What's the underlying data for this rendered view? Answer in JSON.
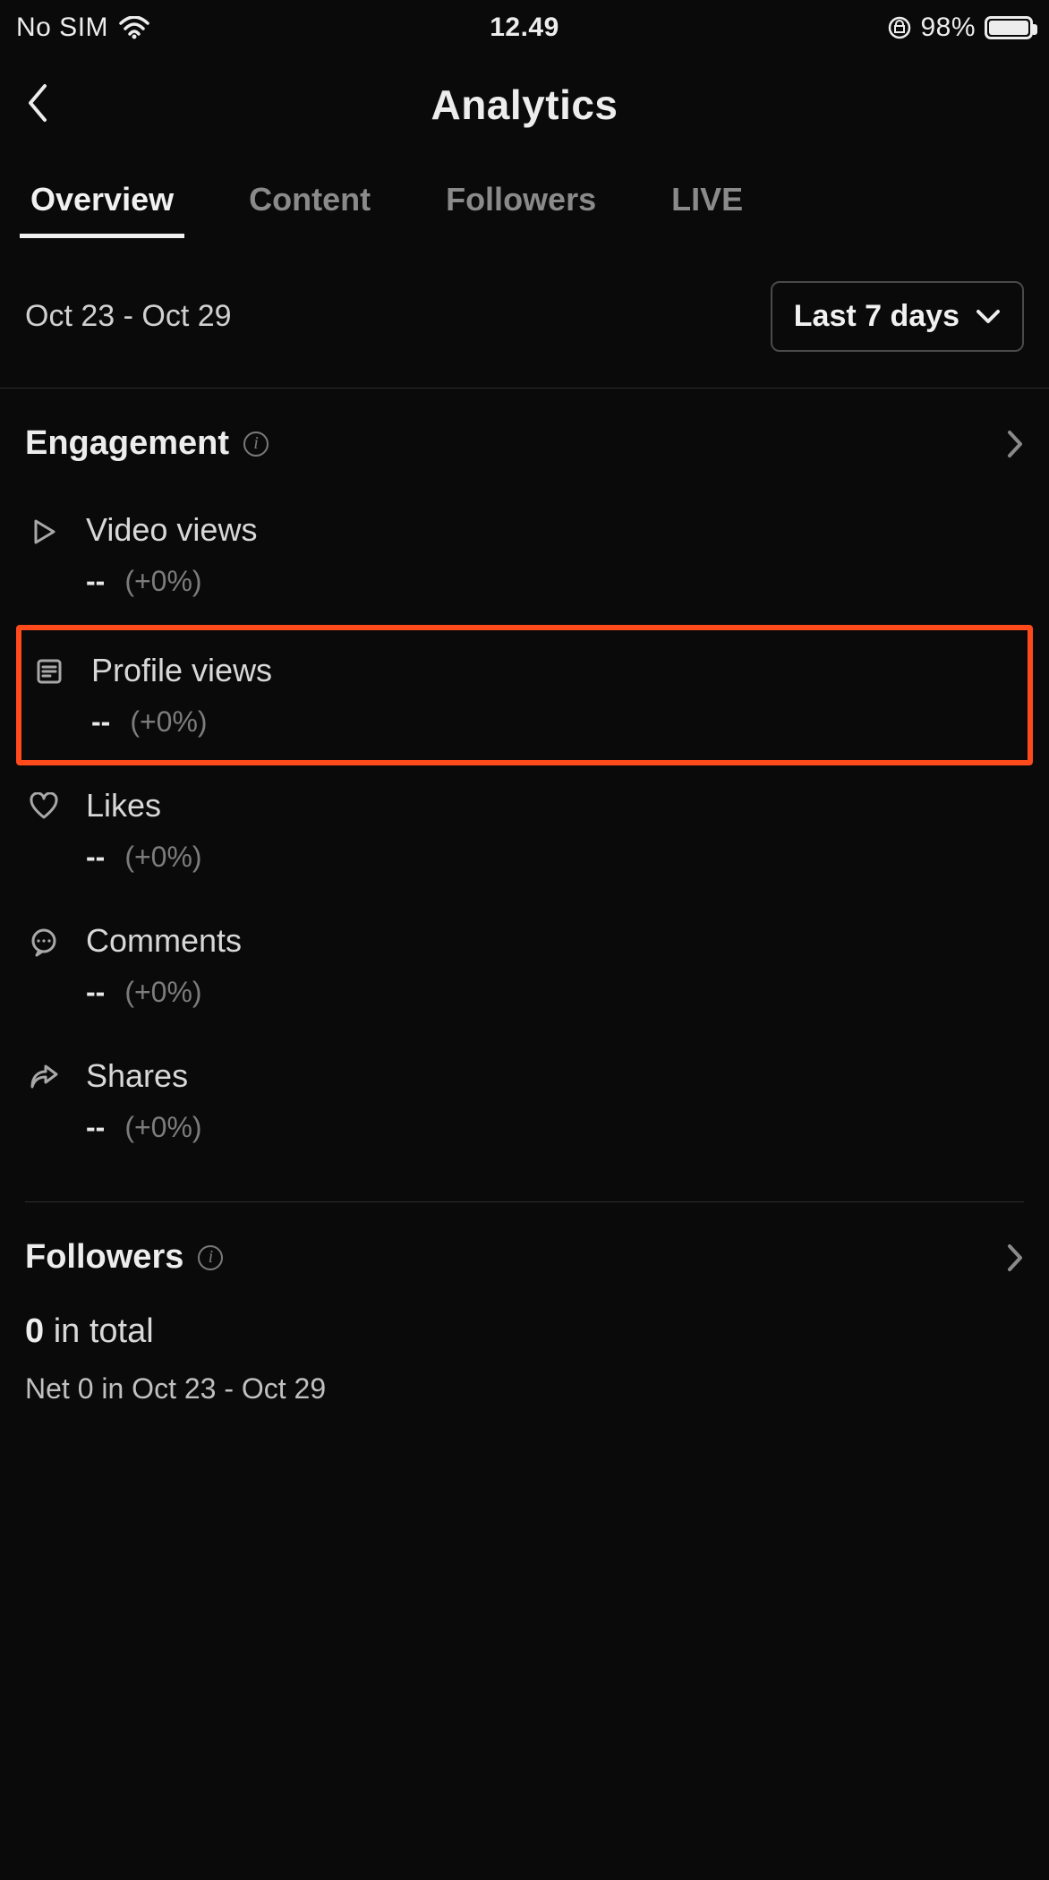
{
  "status": {
    "carrier": "No SIM",
    "time": "12.49",
    "battery_pct": "98%"
  },
  "header": {
    "title": "Analytics"
  },
  "tabs": [
    {
      "label": "Overview",
      "active": true
    },
    {
      "label": "Content",
      "active": false
    },
    {
      "label": "Followers",
      "active": false
    },
    {
      "label": "LIVE",
      "active": false
    }
  ],
  "filter": {
    "date_range": "Oct 23 - Oct 29",
    "range_label": "Last 7 days"
  },
  "engagement": {
    "title": "Engagement",
    "metrics": [
      {
        "icon": "play",
        "label": "Video views",
        "value": "--",
        "delta": "(+0%)",
        "highlight": false
      },
      {
        "icon": "profile",
        "label": "Profile views",
        "value": "--",
        "delta": "(+0%)",
        "highlight": true
      },
      {
        "icon": "heart",
        "label": "Likes",
        "value": "--",
        "delta": "(+0%)",
        "highlight": false
      },
      {
        "icon": "comment",
        "label": "Comments",
        "value": "--",
        "delta": "(+0%)",
        "highlight": false
      },
      {
        "icon": "share",
        "label": "Shares",
        "value": "--",
        "delta": "(+0%)",
        "highlight": false
      }
    ]
  },
  "followers_section": {
    "title": "Followers",
    "total_value": "0",
    "total_suffix": " in total",
    "net_line": "Net 0 in Oct 23 - Oct 29"
  }
}
